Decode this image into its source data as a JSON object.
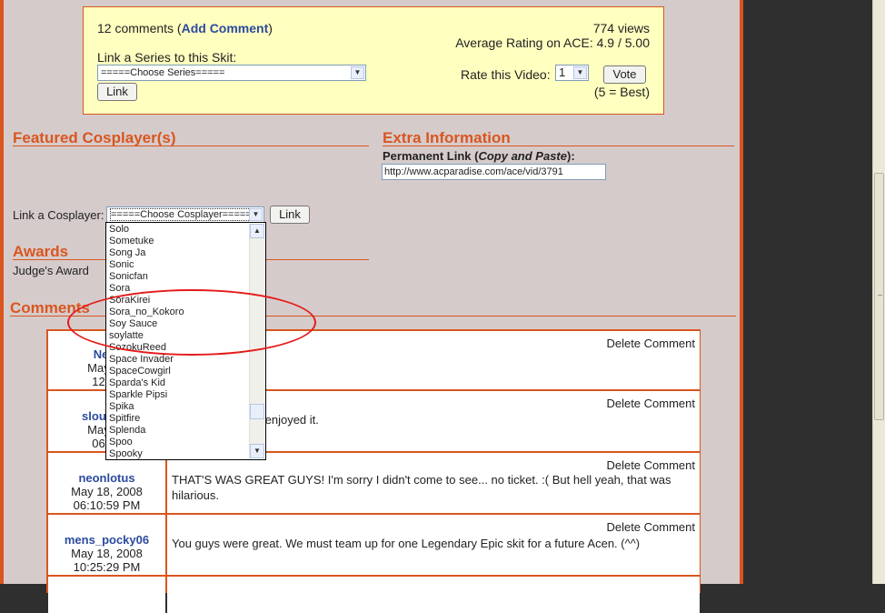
{
  "rating_box": {
    "comments_prefix": "12 comments (",
    "add_comment_link": "Add Comment",
    "comments_suffix": ")",
    "link_series_label": "Link a Series to this Skit:",
    "series_select_value": "=====Choose Series=====",
    "link_button": "Link",
    "views": "774 views",
    "average_rating": "Average Rating on ACE: 4.9 / 5.00",
    "rate_label": "Rate this Video:",
    "rate_select_value": "1",
    "vote_button": "Vote",
    "scale_note": "(5 = Best)"
  },
  "featured": {
    "title": "Featured Cosplayer(s)",
    "link_cosplayer_label": "Link a Cosplayer:",
    "cosplayer_select_value": "=====Choose Cosplayer=====",
    "link_button": "Link"
  },
  "extra": {
    "title": "Extra Information",
    "permanent_link_label_prefix": "Permanent Link (",
    "permanent_link_label_emph": "Copy and Paste",
    "permanent_link_label_suffix": "):",
    "permanent_link_value": "http://www.acparadise.com/ace/vid/3791"
  },
  "awards": {
    "title": "Awards",
    "award": "Judge's Award"
  },
  "comments_section": {
    "title": "Comments",
    "delete_label": "Delete Comment",
    "rows": [
      {
        "user": "Nerd",
        "date": "May 18",
        "time": "12:51",
        "text": ""
      },
      {
        "user": "sloutystr",
        "date": "May 18",
        "time": "06:02",
        "text": "fun to do. I highly enjoyed it."
      },
      {
        "user": "neonlotus",
        "date": "May 18, 2008",
        "time": "06:10:59 PM",
        "text": "THAT'S WAS GREAT GUYS! I'm sorry I didn't come to see... no ticket. :( But hell yeah, that was hilarious."
      },
      {
        "user": "mens_pocky06",
        "date": "May 18, 2008",
        "time": "10:25:29 PM",
        "text": "You guys were great. We must team up for one Legendary Epic skit for a future Acen. (^^)"
      }
    ]
  },
  "cosplayer_dropdown": {
    "options": [
      "Solo",
      "Sometuke",
      "Song Ja",
      "Sonic",
      "Sonicfan",
      "Sora",
      "SoraKirei",
      "Sora_no_Kokoro",
      "Soy Sauce",
      "soylatte",
      "SozokuReed",
      "Space Invader",
      "SpaceCowgirl",
      "Sparda's Kid",
      "Sparkle Pipsi",
      "Spika",
      "Spitfire",
      "Splenda",
      "Spoo",
      "Spooky"
    ]
  },
  "colors": {
    "accent": "#d9561f",
    "content_bg": "#d6cbcb",
    "rating_bg": "#ffffc0",
    "link": "#2c4b9e",
    "annotation": "#e51b1b"
  }
}
